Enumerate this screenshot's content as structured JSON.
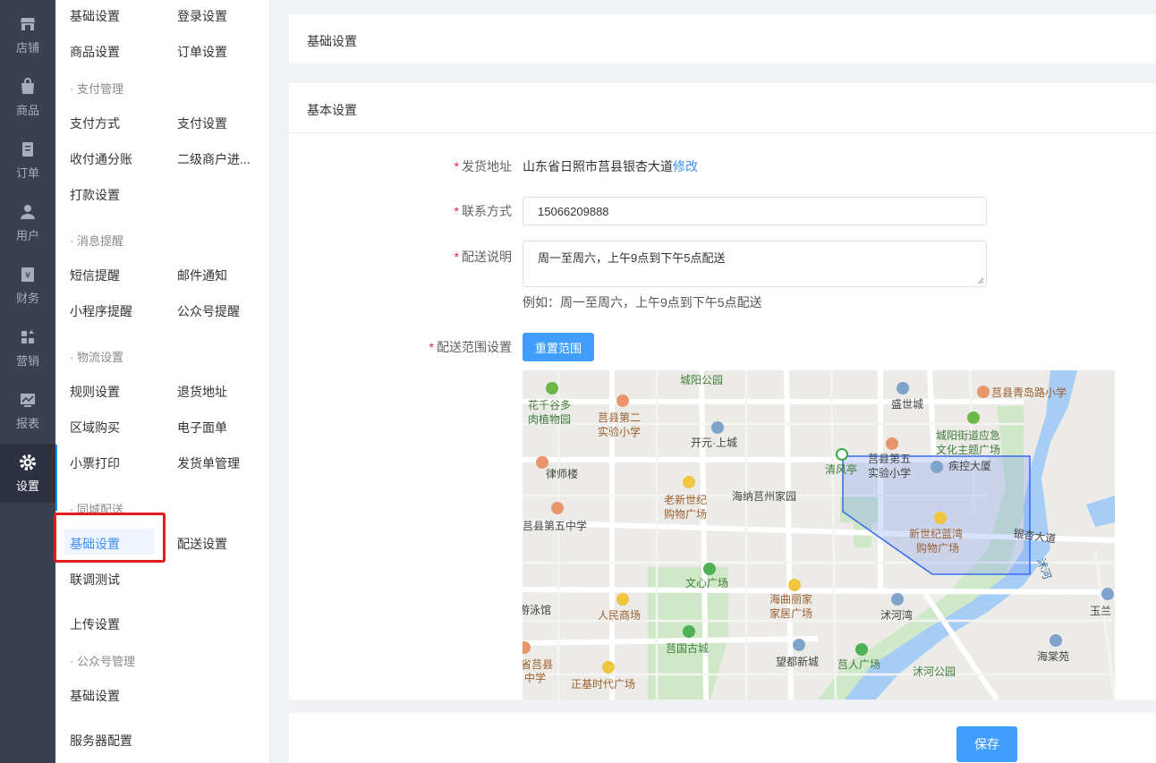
{
  "rail": {
    "items": [
      {
        "label": "店铺",
        "icon": "store-icon"
      },
      {
        "label": "商品",
        "icon": "bag-icon"
      },
      {
        "label": "订单",
        "icon": "order-icon"
      },
      {
        "label": "用户",
        "icon": "user-icon"
      },
      {
        "label": "财务",
        "icon": "finance-icon"
      },
      {
        "label": "营销",
        "icon": "marketing-icon"
      },
      {
        "label": "报表",
        "icon": "report-icon"
      },
      {
        "label": "设置",
        "icon": "gear-icon",
        "active": true
      }
    ]
  },
  "submenu": {
    "row1": [
      "基础设置",
      "登录设置"
    ],
    "row2": [
      "商品设置",
      "订单设置"
    ],
    "group_payment": "· 支付管理",
    "row3": [
      "支付方式",
      "支付设置"
    ],
    "row4": [
      "收付通分账",
      "二级商户进..."
    ],
    "row5": [
      "打款设置"
    ],
    "group_message": "· 消息提醒",
    "row6": [
      "短信提醒",
      "邮件通知"
    ],
    "row7": [
      "小程序提醒",
      "公众号提醒"
    ],
    "group_logistics": "· 物流设置",
    "row8": [
      "规则设置",
      "退货地址"
    ],
    "row9": [
      "区域购买",
      "电子面单"
    ],
    "row10": [
      "小票打印",
      "发货单管理"
    ],
    "group_local": "· 同城配送",
    "row11": [
      "基础设置",
      "配送设置"
    ],
    "row12": [
      "联调测试"
    ],
    "row13": [
      "上传设置"
    ],
    "group_wechat": "· 公众号管理",
    "row14": [
      "基础设置"
    ],
    "row15": [
      "服务器配置"
    ]
  },
  "header_card": {
    "title": "基础设置"
  },
  "form_card": {
    "title": "基本设置",
    "ship_address": {
      "label": "发货地址",
      "value": "山东省日照市莒县银杏大道",
      "edit_link": "修改"
    },
    "contact": {
      "label": "联系方式",
      "value": "15066209888"
    },
    "delivery_note": {
      "label": "配送说明",
      "value": "周一至周六，上午9点到下午5点配送",
      "hint": "例如：周一至周六，上午9点到下午5点配送"
    },
    "range": {
      "label": "配送范围设置",
      "reset_button": "重置范围"
    }
  },
  "map": {
    "labels": {
      "l1": "城阳公园",
      "l2": "花千谷多",
      "l3": "肉植物园",
      "l4": "莒县第二",
      "l5": "实验小学",
      "l6": "开元·上城",
      "l7": "盛世城",
      "l8": "莒县青岛路小学",
      "l9": "城阳街道应急",
      "l10": "文化主题广场",
      "l11": "律师楼",
      "l12": "清风亭",
      "l13": "莒县第五",
      "l14": "实验小学",
      "l15": "疾控大厦",
      "l16": "老新世纪",
      "l17": "购物广场",
      "l18": "海纳莒州家园",
      "l19": "莒县第五中学",
      "l20": "新世纪蓝湾",
      "l21": "购物广场",
      "l22": "银杏大道",
      "l23": "沭河",
      "l24": "文心广场",
      "l25": "海曲丽家",
      "l26": "家居广场",
      "l27": "沭河湾",
      "l28": "玉兰",
      "l29": "游泳馆",
      "l30": "人民商场",
      "l31": "莒国古城",
      "l32": "望都新城",
      "l33": "莒人广场",
      "l34": "沭河公园",
      "l35": "海棠苑",
      "l36": "省莒县",
      "l37": "中学",
      "l38": "正基时代广场"
    }
  },
  "footer": {
    "save_button": "保存"
  },
  "colors": {
    "primary": "#409eff",
    "rail_bg": "#3a3f51",
    "highlight": "#e41c1c",
    "required": "#f5222d"
  }
}
